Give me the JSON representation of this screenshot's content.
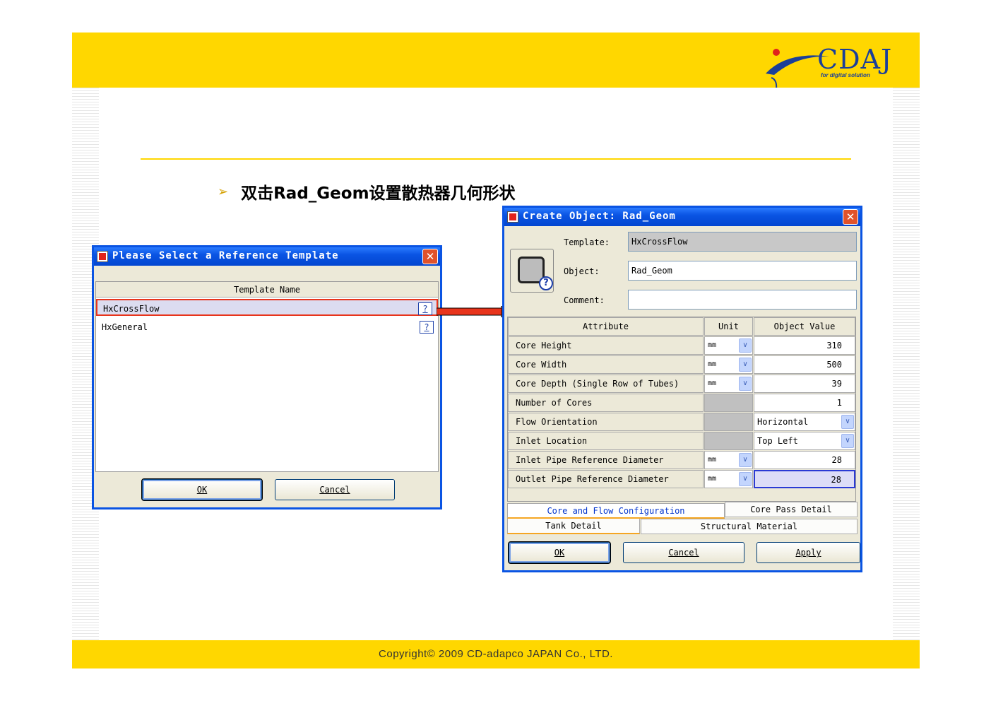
{
  "slide": {
    "bullet_text": "双击Rad_Geom设置散热器几何形状",
    "logo_text": "CDAJ",
    "logo_tagline": "for digital solution",
    "copyright": "Copyright© 2009 CD-adapco JAPAN Co., LTD."
  },
  "colors": {
    "band": "#ffd700",
    "titlebar": "#0a54e3",
    "highlight_border": "#e8341c",
    "arrow": "#e8341c"
  },
  "template_dialog": {
    "title": "Please Select a Reference Template",
    "close_icon": "close-icon",
    "column_header": "Template Name",
    "rows": [
      {
        "name": "HxCrossFlow",
        "help": "?"
      },
      {
        "name": "HxGeneral",
        "help": "?"
      }
    ],
    "ok_label": "OK",
    "cancel_label": "Cancel"
  },
  "create_dialog": {
    "title": "Create Object: Rad_Geom",
    "template_label": "Template:",
    "template_value": "HxCrossFlow",
    "object_label": "Object:",
    "object_value": "Rad_Geom",
    "comment_label": "Comment:",
    "comment_value": "",
    "headers": {
      "attribute": "Attribute",
      "unit": "Unit",
      "value": "Object Value"
    },
    "rows": [
      {
        "attribute": "Core Height",
        "unit": "mm",
        "value": "310"
      },
      {
        "attribute": "Core Width",
        "unit": "mm",
        "value": "500"
      },
      {
        "attribute": "Core Depth (Single Row of Tubes)",
        "unit": "mm",
        "value": "39"
      },
      {
        "attribute": "Number of Cores",
        "unit": "",
        "value": "1"
      },
      {
        "attribute": "Flow Orientation",
        "unit": "",
        "value": "Horizontal"
      },
      {
        "attribute": "Inlet Location",
        "unit": "",
        "value": "Top Left"
      },
      {
        "attribute": "Inlet Pipe Reference Diameter",
        "unit": "mm",
        "value": "28"
      },
      {
        "attribute": "Outlet Pipe Reference Diameter",
        "unit": "mm",
        "value": "28"
      }
    ],
    "tabs": {
      "core_flow": "Core and Flow Configuration",
      "core_pass": "Core Pass Detail",
      "tank": "Tank Detail",
      "structural": "Structural Material"
    },
    "ok_label": "OK",
    "cancel_label": "Cancel",
    "apply_label": "Apply"
  }
}
